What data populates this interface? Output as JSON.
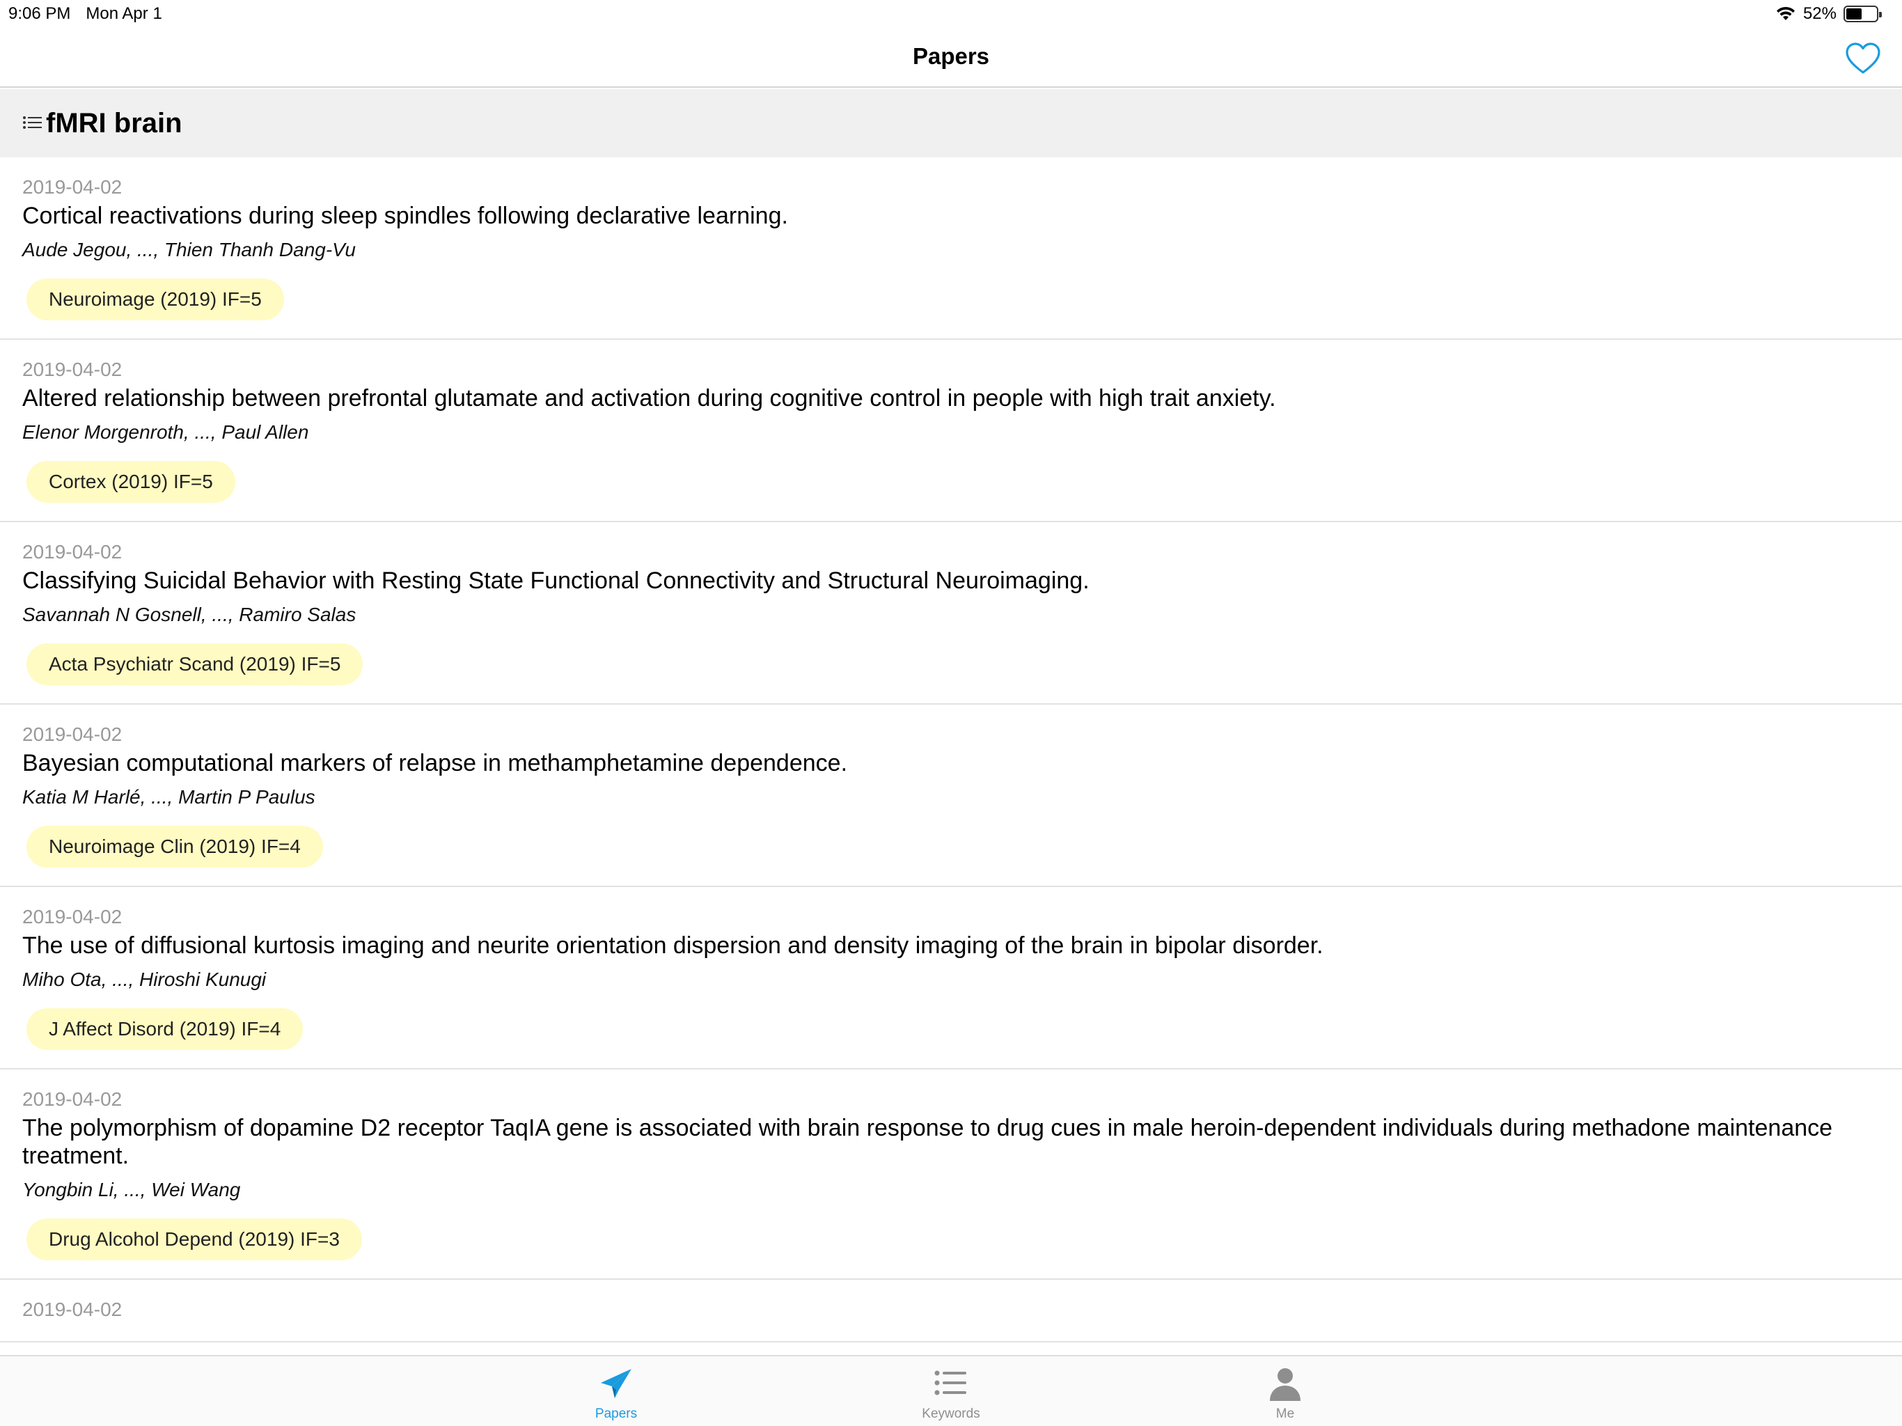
{
  "status_bar": {
    "time": "9:06 PM",
    "date": "Mon Apr 1",
    "battery": "52%",
    "battery_level": 0.52
  },
  "nav": {
    "title": "Papers"
  },
  "section": {
    "title": "fMRI brain"
  },
  "papers": [
    {
      "date": "2019-04-02",
      "title": "Cortical reactivations during sleep spindles following declarative learning.",
      "authors": "Aude Jegou, ..., Thien Thanh Dang-Vu",
      "journal": "Neuroimage (2019)  IF=5"
    },
    {
      "date": "2019-04-02",
      "title": "Altered relationship between prefrontal glutamate and activation during cognitive control in people with high trait anxiety.",
      "authors": "Elenor Morgenroth, ..., Paul Allen",
      "journal": "Cortex (2019)  IF=5"
    },
    {
      "date": "2019-04-02",
      "title": "Classifying Suicidal Behavior with Resting State Functional Connectivity and Structural Neuroimaging.",
      "authors": "Savannah N Gosnell, ..., Ramiro Salas",
      "journal": "Acta Psychiatr Scand (2019)  IF=5"
    },
    {
      "date": "2019-04-02",
      "title": "Bayesian computational markers of relapse in methamphetamine dependence.",
      "authors": "Katia M Harlé, ..., Martin P Paulus",
      "journal": "Neuroimage Clin (2019)  IF=4"
    },
    {
      "date": "2019-04-02",
      "title": "The use of diffusional kurtosis imaging and neurite orientation dispersion and density imaging of the brain in bipolar disorder.",
      "authors": "Miho Ota, ..., Hiroshi Kunugi",
      "journal": "J Affect Disord (2019)  IF=4"
    },
    {
      "date": "2019-04-02",
      "title": "The polymorphism of dopamine D2 receptor TaqIA gene is associated with brain response to drug cues in male heroin-dependent individuals during methadone maintenance treatment.",
      "authors": "Yongbin Li, ..., Wei Wang",
      "journal": "Drug Alcohol Depend (2019)  IF=3"
    },
    {
      "date": "2019-04-02",
      "title": "",
      "authors": "",
      "journal": ""
    }
  ],
  "tabs": [
    {
      "label": "Papers",
      "icon": "paper-plane-icon",
      "active": true
    },
    {
      "label": "Keywords",
      "icon": "list-icon",
      "active": false
    },
    {
      "label": "Me",
      "icon": "person-icon",
      "active": false
    }
  ],
  "colors": {
    "accent": "#1a9be0",
    "tag_background": "#fffbc2",
    "section_background": "#f0f0f0",
    "date_text": "#999999"
  }
}
